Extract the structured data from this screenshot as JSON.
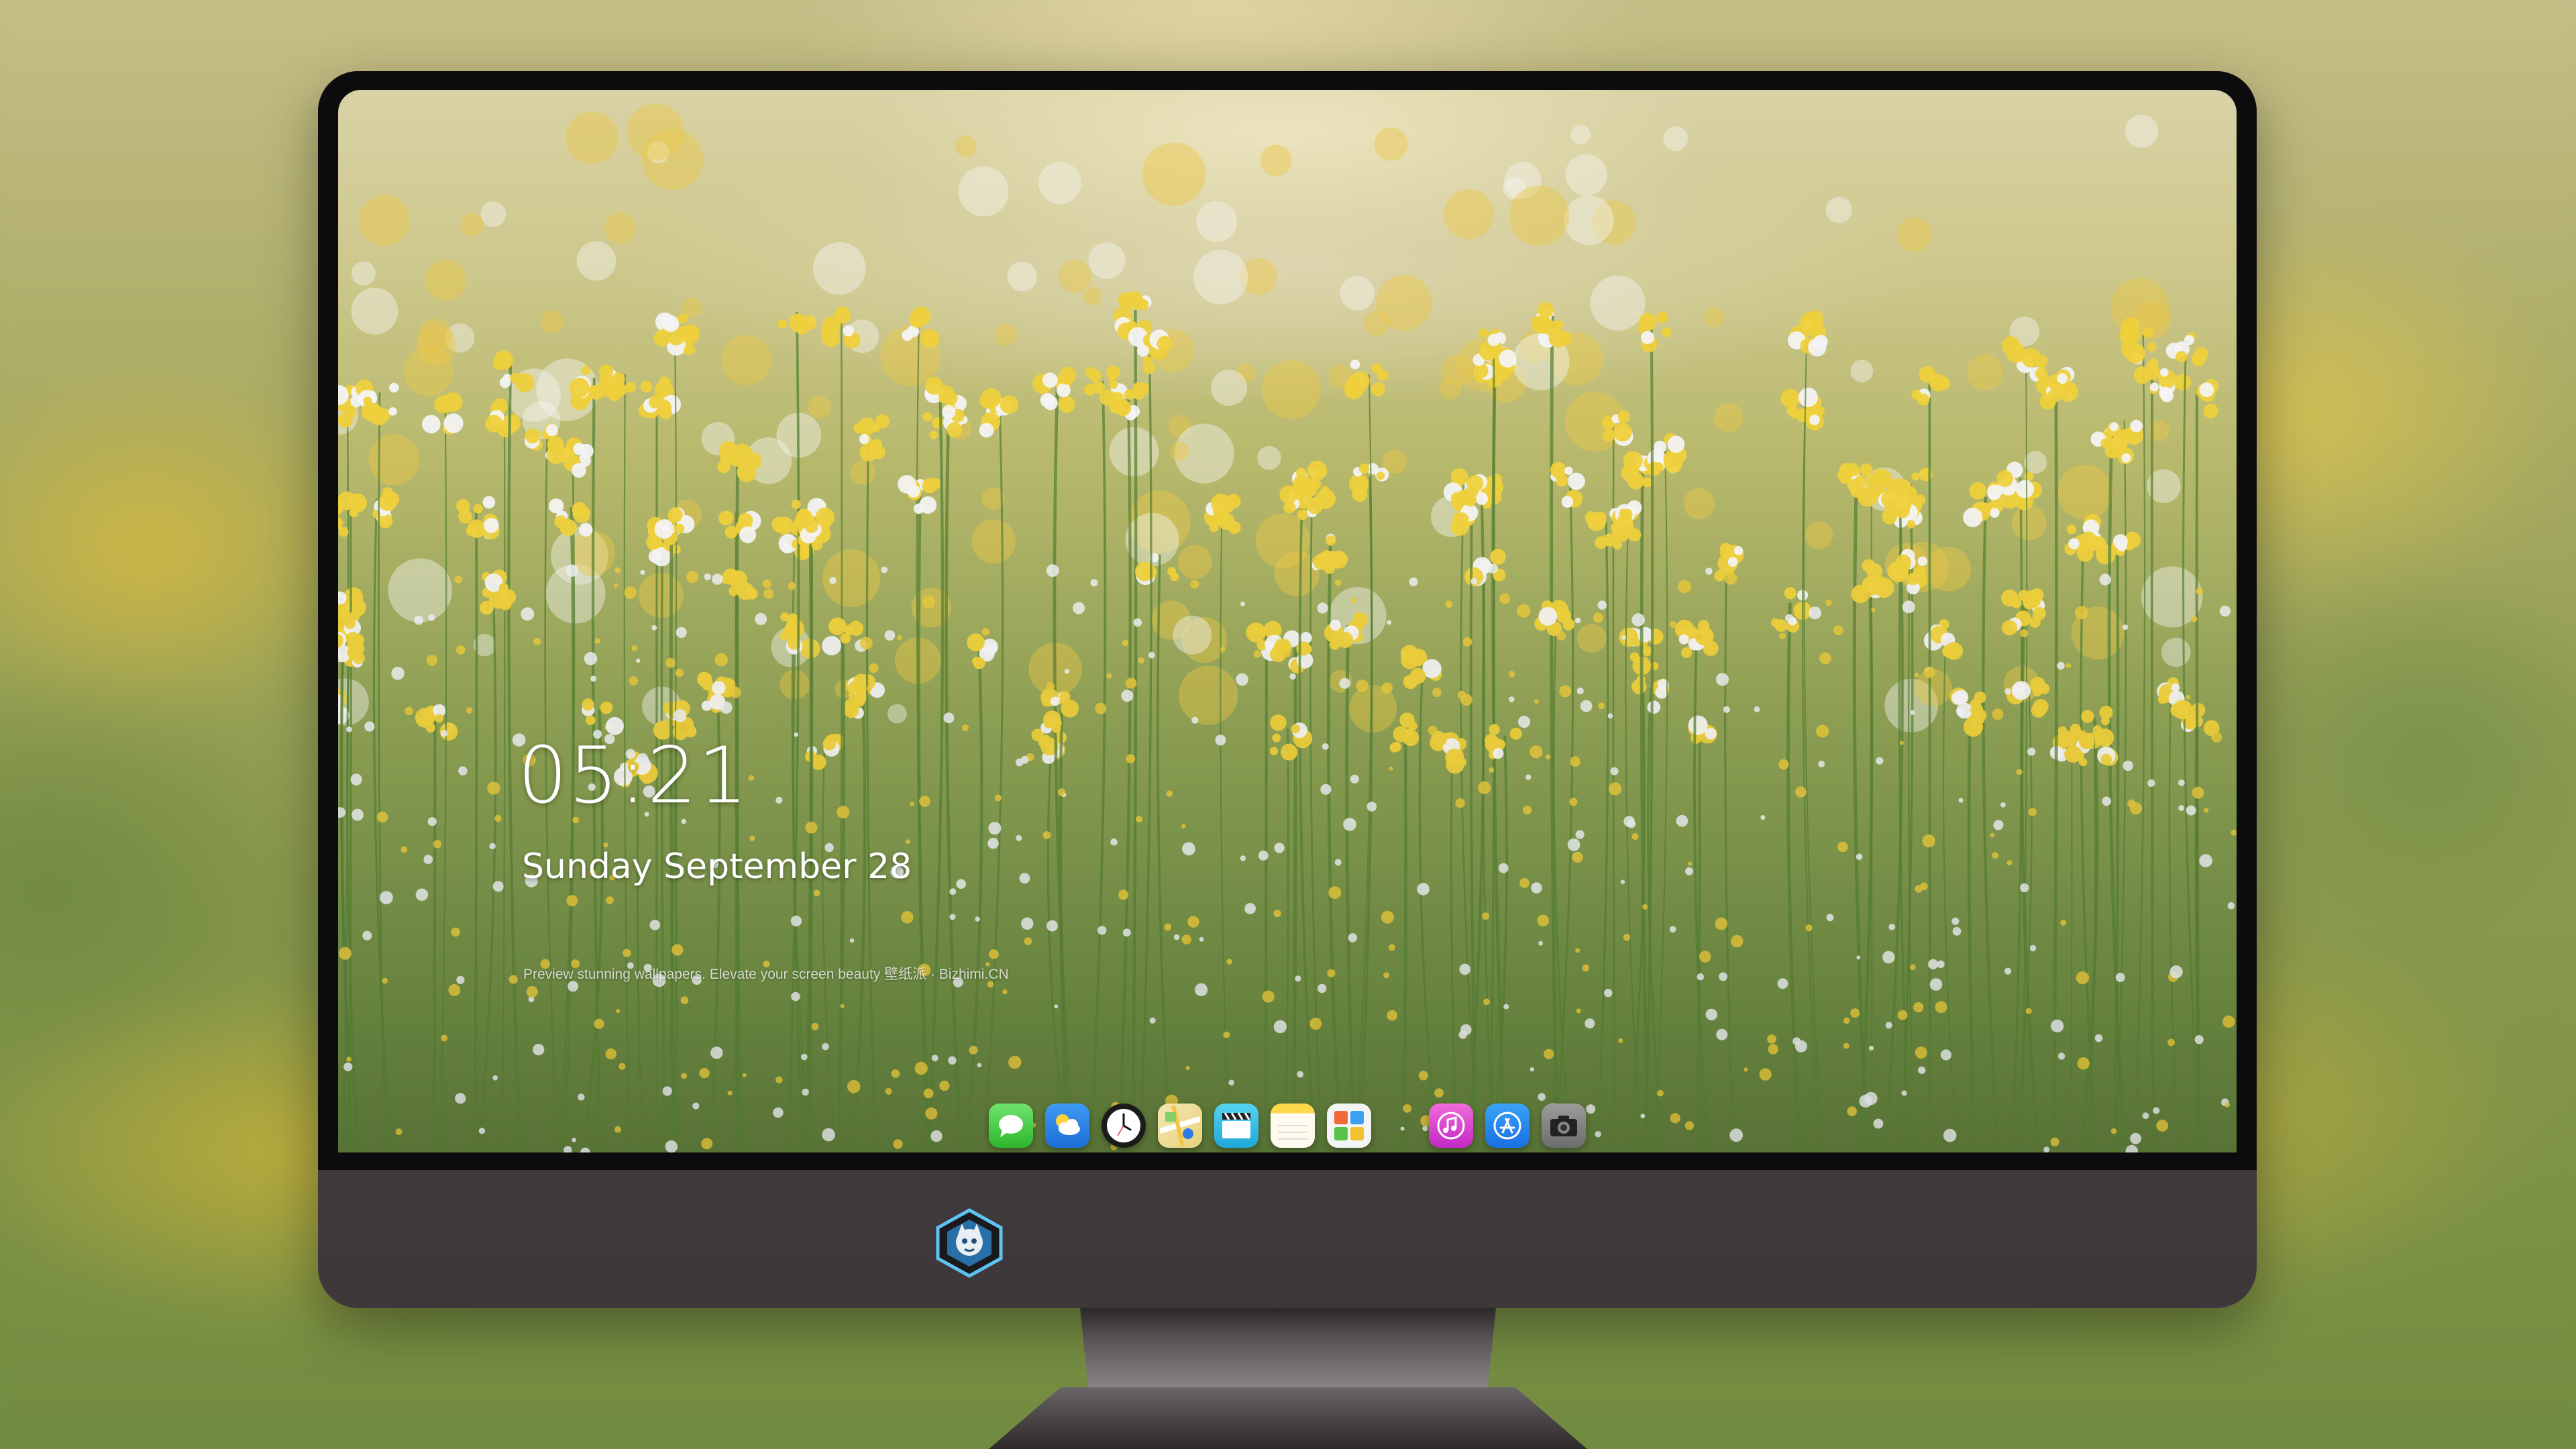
{
  "lock_screen": {
    "time": "05:21",
    "date": "Sunday September  28",
    "tagline": "Preview stunning wallpapers. Elevate your screen beauty  壁纸派 · Bizhimi.CN"
  },
  "dock": {
    "apps": [
      {
        "name": "Messages",
        "icon": "messages-icon"
      },
      {
        "name": "Weather",
        "icon": "weather-icon"
      },
      {
        "name": "Clock",
        "icon": "clock-icon"
      },
      {
        "name": "Maps",
        "icon": "maps-icon"
      },
      {
        "name": "Clips",
        "icon": "clapperboard-icon"
      },
      {
        "name": "Notes",
        "icon": "notes-icon"
      },
      {
        "name": "Photos",
        "icon": "photos-icon"
      },
      {
        "name": "iTunes Store",
        "icon": "music-note-icon"
      },
      {
        "name": "App Store",
        "icon": "app-store-icon"
      },
      {
        "name": "Camera",
        "icon": "camera-icon"
      }
    ]
  },
  "monitor": {
    "chin_logo": "dragon-mascot-logo"
  },
  "colors": {
    "bezel": "#0c0c0e",
    "chin": "#443d40",
    "text": "#ffffff"
  }
}
